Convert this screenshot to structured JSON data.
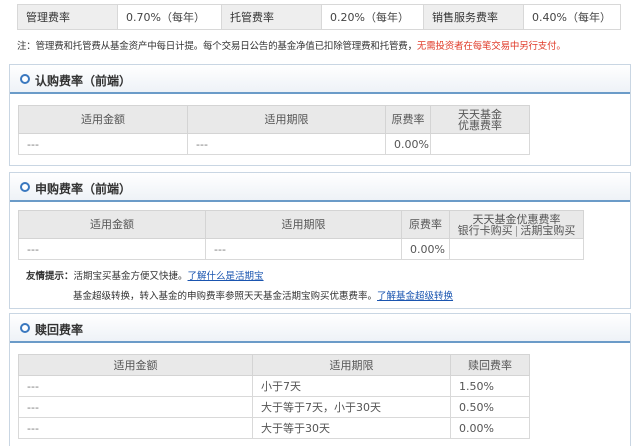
{
  "fee_rates": [
    {
      "label": "管理费率",
      "value": "0.70%（每年）"
    },
    {
      "label": "托管费率",
      "value": "0.20%（每年）"
    },
    {
      "label": "销售服务费率",
      "value": "0.40%（每年）"
    }
  ],
  "note": {
    "text": "注：管理费和托管费从基金资产中每日计提。每个交易日公告的基金净值已扣除管理费和托管费，",
    "highlight": "无需投资者在每笔交易中另行支付。",
    "highlight_color": "#e03c2b"
  },
  "subscription": {
    "title": "认购费率（前端）",
    "headers": [
      "适用金额",
      "适用期限",
      "原费率",
      "天天基金",
      "优惠费率"
    ],
    "row": {
      "amount": "---",
      "period": "---",
      "rate": "0.00%",
      "discount": ""
    }
  },
  "purchase": {
    "title": "申购费率（前端）",
    "headers": [
      "适用金额",
      "适用期限",
      "原费率",
      "天天基金优惠费率",
      "银行卡购买",
      "活期宝购买"
    ],
    "row": {
      "amount": "---",
      "period": "---",
      "rate": "0.00%",
      "bank": "",
      "wallet": ""
    },
    "tip1_label": "友情提示：",
    "tip1_text": "活期宝买基金方便又快捷。",
    "tip1_link": "了解什么是活期宝",
    "tip2_text": "基金超级转换，转入基金的申购费率参照天天基金活期宝购买优惠费率。",
    "tip2_link": "了解基金超级转换"
  },
  "redemption": {
    "title": "赎回费率",
    "headers": [
      "适用金额",
      "适用期限",
      "赎回费率"
    ],
    "rows": [
      {
        "amount": "---",
        "period": "小于7天",
        "rate": "1.50%"
      },
      {
        "amount": "---",
        "period": "大于等于7天，小于30天",
        "rate": "0.50%"
      },
      {
        "amount": "---",
        "period": "大于等于30天",
        "rate": "0.00%"
      }
    ]
  },
  "colors": {
    "accent": "#3a78bf",
    "link": "#1a55b0"
  },
  "icons": {
    "section_marker": "circle-bullet-icon"
  }
}
